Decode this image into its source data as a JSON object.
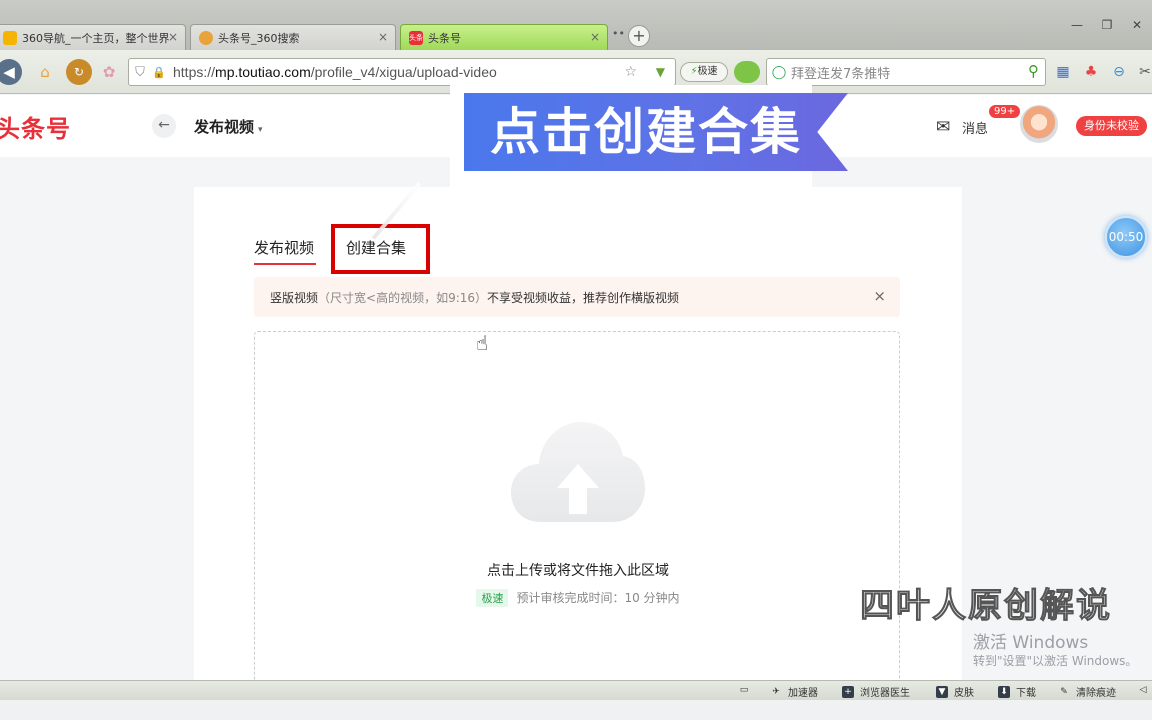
{
  "browser": {
    "tabs": [
      {
        "label": "360导航_一个主页，整个世界",
        "active": false
      },
      {
        "label": "头条号_360搜索",
        "active": false
      },
      {
        "label": "头条号",
        "active": true
      }
    ],
    "tab_close": "×",
    "tab_more": "••",
    "tab_plus": "+",
    "window": {
      "minimize": "—",
      "restore": "❐",
      "close": "✕"
    },
    "url": {
      "prefix": "https://",
      "domain": "mp.toutiao.com",
      "path": "/profile_v4/xigua/upload-video"
    },
    "speed_button": "极速",
    "search_placeholder": "拜登连发7条推特",
    "status_bar": {
      "accelerator": "加速器",
      "doctor": "浏览器医生",
      "skin": "皮肤",
      "download": "下载",
      "clear_traces": "清除痕迹"
    }
  },
  "page": {
    "logo": "头条号",
    "back": "←",
    "title": "发布视频",
    "title_caret": "▾",
    "messages_label": "消息",
    "messages_badge": "99+",
    "verify_badge": "身份未校验",
    "tabs": {
      "publish": "发布视频",
      "collection": "创建合集"
    },
    "notice": {
      "lead": "竖版视频",
      "paren": "（尺寸宽<高的视频，如9:16）",
      "tail": "不享受视频收益，推荐创作横版视频",
      "close": "×"
    },
    "dropzone": {
      "main_text": "点击上传或将文件拖入此区域",
      "speed_tag": "极速",
      "sub_text": "预计审核完成时间：10 分钟内"
    },
    "timer": "00:50"
  },
  "overlay": {
    "banner": "点击创建合集",
    "watermark": "四叶人原创解说",
    "windows_activation_title": "激活 Windows",
    "windows_activation_sub": "转到\"设置\"以激活 Windows。"
  },
  "colors": {
    "brand_red": "#e8303a",
    "active_tab_green": "#9fd95a",
    "highlight_box": "#d90000",
    "banner_blue": "#4a78ec"
  }
}
